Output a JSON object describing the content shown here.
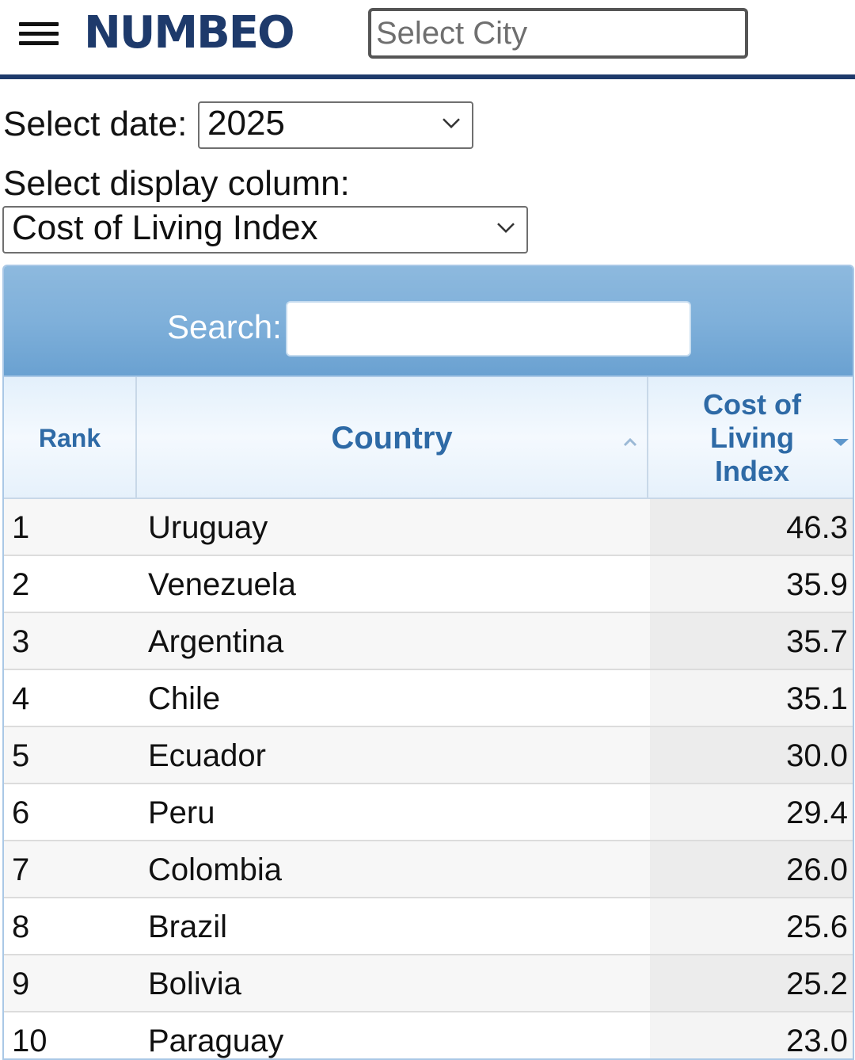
{
  "header": {
    "logo": "NUMBEO",
    "menu_icon": "hamburger-menu-icon",
    "city_placeholder": "Select City",
    "accent_color": "#1e3a6b"
  },
  "filters": {
    "date_label": "Select date:",
    "date_value": "2025",
    "column_label": "Select display column:",
    "column_value": "Cost of Living Index"
  },
  "table": {
    "search_label": "Search:",
    "search_value": "",
    "columns": [
      "Rank",
      "Country",
      "Cost of Living Index"
    ],
    "sort": {
      "country": "ascending-indicator",
      "cost_of_living_index": "descending-active"
    },
    "rows": [
      {
        "rank": "1",
        "country": "Uruguay",
        "value": "46.3"
      },
      {
        "rank": "2",
        "country": "Venezuela",
        "value": "35.9"
      },
      {
        "rank": "3",
        "country": "Argentina",
        "value": "35.7"
      },
      {
        "rank": "4",
        "country": "Chile",
        "value": "35.1"
      },
      {
        "rank": "5",
        "country": "Ecuador",
        "value": "30.0"
      },
      {
        "rank": "6",
        "country": "Peru",
        "value": "29.4"
      },
      {
        "rank": "7",
        "country": "Colombia",
        "value": "26.0"
      },
      {
        "rank": "8",
        "country": "Brazil",
        "value": "25.6"
      },
      {
        "rank": "9",
        "country": "Bolivia",
        "value": "25.2"
      },
      {
        "rank": "10",
        "country": "Paraguay",
        "value": "23.0"
      }
    ]
  }
}
